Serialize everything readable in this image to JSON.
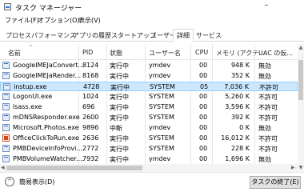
{
  "window": {
    "title": "タスク マネージャー",
    "minimize": "–"
  },
  "menu": [
    "ファイル(F)",
    "オプション(O)",
    "表示(V)"
  ],
  "tabs": [
    "プロセス",
    "パフォーマンス",
    "アプリの履歴",
    "スタートアップ",
    "ユーザー",
    "詳細",
    "サービス"
  ],
  "active_tab": "詳細",
  "table": {
    "sort_indicator": "^",
    "columns": [
      "名前",
      "PID",
      "状態",
      "ユーザー名",
      "CPU",
      "メモリ (アクテ...",
      "UAC の仮..."
    ],
    "rows": [
      {
        "name": "GoogleIMEJaConvert...",
        "pid": "8124",
        "status": "実行中",
        "user": "ymdev",
        "cpu": "00",
        "memory": "948 K",
        "uac": "無効",
        "icon": "app"
      },
      {
        "name": "GoogleIMEJaRender...",
        "pid": "8168",
        "status": "実行中",
        "user": "ymdev",
        "cpu": "00",
        "memory": "352 K",
        "uac": "無効",
        "icon": "app"
      },
      {
        "name": "instup.exe",
        "pid": "4728",
        "status": "実行中",
        "user": "SYSTEM",
        "cpu": "05",
        "memory": "7,036 K",
        "uac": "不許可",
        "icon": "app",
        "selected": true
      },
      {
        "name": "LogonUI.exe",
        "pid": "1024",
        "status": "実行中",
        "user": "SYSTEM",
        "cpu": "00",
        "memory": "5,260 K",
        "uac": "不許可",
        "icon": "app"
      },
      {
        "name": "lsass.exe",
        "pid": "696",
        "status": "実行中",
        "user": "SYSTEM",
        "cpu": "00",
        "memory": "3,596 K",
        "uac": "不許可",
        "icon": "app"
      },
      {
        "name": "mDNSResponder.exe",
        "pid": "2600",
        "status": "実行中",
        "user": "SYSTEM",
        "cpu": "00",
        "memory": "392 K",
        "uac": "不許可",
        "icon": "app"
      },
      {
        "name": "Microsoft.Photos.exe",
        "pid": "9896",
        "status": "中断",
        "user": "ymdev",
        "cpu": "00",
        "memory": "0 K",
        "uac": "無効",
        "icon": "app"
      },
      {
        "name": "OfficeClickToRun.exe",
        "pid": "2636",
        "status": "実行中",
        "user": "SYSTEM",
        "cpu": "00",
        "memory": "16,012 K",
        "uac": "不許可",
        "icon": "office"
      },
      {
        "name": "PMBDeviceInfoProvi...",
        "pid": "2772",
        "status": "実行中",
        "user": "SYSTEM",
        "cpu": "00",
        "memory": "228 K",
        "uac": "不許可",
        "icon": "app"
      },
      {
        "name": "PMBVolumeWatcher....",
        "pid": "7932",
        "status": "実行中",
        "user": "ymdev",
        "cpu": "00",
        "memory": "1,696 K",
        "uac": "無効",
        "icon": "app"
      }
    ]
  },
  "footer": {
    "fewer_details": "簡易表示(D)",
    "end_task": "タスクの終了(E)",
    "collapse_icon": "^"
  }
}
